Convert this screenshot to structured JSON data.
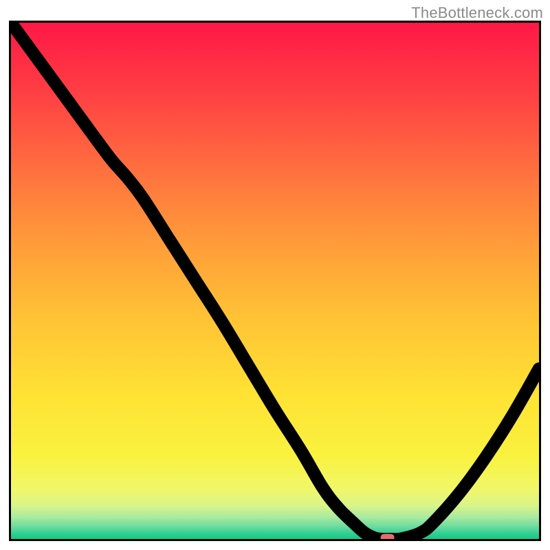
{
  "watermark": "TheBottleneck.com",
  "chart_data": {
    "type": "line",
    "title": "",
    "xlabel": "",
    "ylabel": "",
    "xlim": [
      0,
      100
    ],
    "ylim": [
      0,
      100
    ],
    "x": [
      0,
      5,
      10,
      15,
      19,
      22,
      25,
      30,
      35,
      40,
      45,
      50,
      55,
      59,
      62,
      65,
      67,
      69,
      70.5,
      72,
      74,
      77.5,
      80,
      85,
      90,
      95,
      100
    ],
    "values": [
      100,
      93,
      86,
      79,
      73.5,
      70,
      66,
      58,
      50,
      42,
      33.5,
      25,
      17,
      10,
      6,
      3,
      1.2,
      0.2,
      0,
      0,
      0.1,
      1.2,
      3.2,
      9,
      16,
      24,
      33
    ],
    "marker": {
      "x": 71.3,
      "y": 0
    },
    "gradient_stops": [
      {
        "pos": 0.0,
        "color": "#ff1846"
      },
      {
        "pos": 0.12,
        "color": "#ff3a44"
      },
      {
        "pos": 0.27,
        "color": "#ff6b3f"
      },
      {
        "pos": 0.42,
        "color": "#ff9a3a"
      },
      {
        "pos": 0.57,
        "color": "#ffc235"
      },
      {
        "pos": 0.72,
        "color": "#ffe234"
      },
      {
        "pos": 0.84,
        "color": "#f9f23f"
      },
      {
        "pos": 0.905,
        "color": "#f0f76a"
      },
      {
        "pos": 0.935,
        "color": "#d9f489"
      },
      {
        "pos": 0.958,
        "color": "#a9eaa0"
      },
      {
        "pos": 0.975,
        "color": "#6fdc9f"
      },
      {
        "pos": 0.99,
        "color": "#2ecf92"
      },
      {
        "pos": 1.0,
        "color": "#16c885"
      }
    ],
    "marker_color": "#e46a6f"
  }
}
